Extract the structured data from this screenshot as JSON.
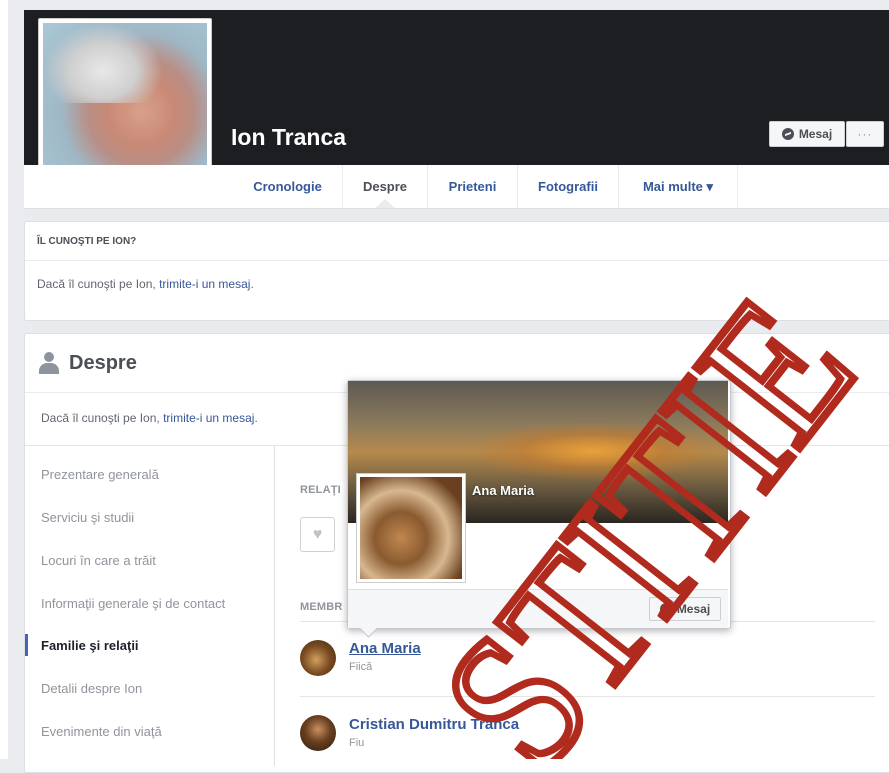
{
  "profile": {
    "name": "Ion Tranca",
    "message_label": "Mesaj",
    "more_label": "···"
  },
  "tabs": [
    {
      "label": "Cronologie"
    },
    {
      "label": "Despre"
    },
    {
      "label": "Prieteni"
    },
    {
      "label": "Fotografii"
    },
    {
      "label": "Mai multe ▾"
    }
  ],
  "know_card": {
    "heading": "ÎL CUNOŞTI PE ION?",
    "text_before": "Dacă îl cunoşti pe Ion, ",
    "link": "trimite-i un mesaj",
    "text_after": "."
  },
  "about": {
    "title": "Despre",
    "text_before": "Dacă îl cunoşti pe Ion, ",
    "link": "trimite-i un mesaj",
    "text_after": ".",
    "sidebar": [
      "Prezentare generală",
      "Serviciu şi studii",
      "Locuri în care a trăit",
      "Informaţii generale şi de contact",
      "Familie şi relaţii",
      "Detalii despre Ion",
      "Evenimente din viaţă"
    ],
    "relations_label": "RELAŢI",
    "members_label": "MEMBR",
    "members": [
      {
        "name": "Ana Maria",
        "relation": "Fiică"
      },
      {
        "name": "Cristian Dumitru Tranca",
        "relation": "Fiu"
      }
    ]
  },
  "hover_card": {
    "name": "Ana Maria",
    "message_label": "Mesaj"
  },
  "watermark": {
    "text": "STITIE",
    "color": "#b02a1e"
  }
}
